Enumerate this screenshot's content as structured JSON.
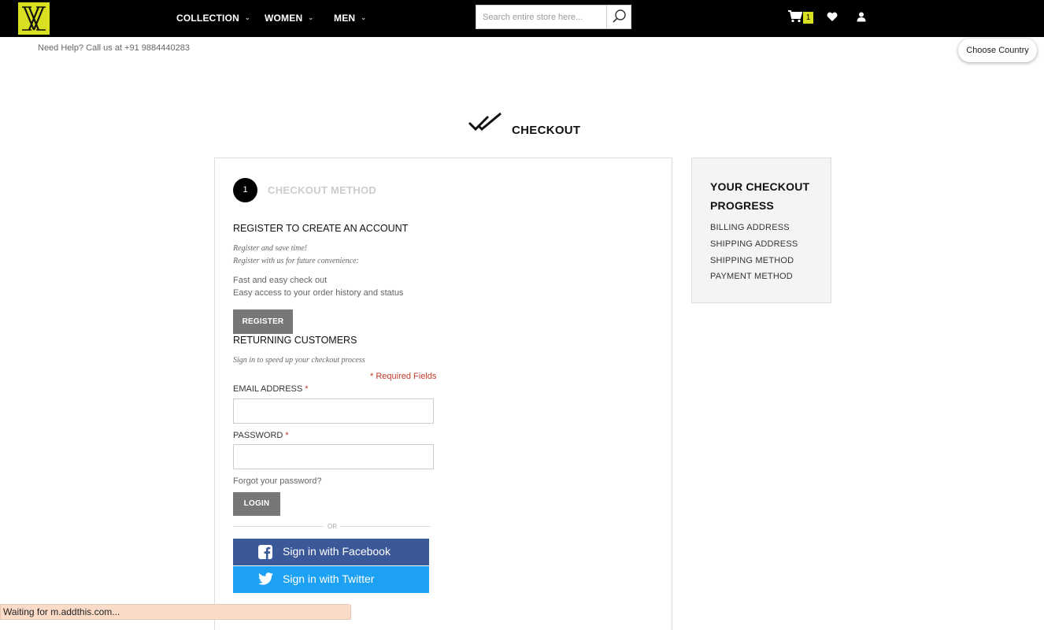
{
  "header": {
    "logo_letter": "XX",
    "nav": [
      {
        "label": "COLLECTION"
      },
      {
        "label": "WOMEN"
      },
      {
        "label": "MEN"
      }
    ],
    "search": {
      "placeholder": "Search entire store here..."
    },
    "cart_count": "1",
    "icons": {
      "search": "magnifier-icon",
      "cart": "cart-icon",
      "wishlist": "heart-icon",
      "account": "user-icon",
      "chevron": "chevron-down-icon"
    },
    "accent_color": "#d9e021"
  },
  "help_text": "Need Help? Call us at +91 9884440283",
  "choose_country": "Choose Country",
  "page_title": "CHECKOUT",
  "checkout_method": {
    "step_number": "1",
    "step_title": "CHECKOUT METHOD",
    "register": {
      "heading": "REGISTER TO CREATE AN ACCOUNT",
      "note_line1": "Register and save time!",
      "note_line2": "Register with us for future convenience:",
      "benefit1": "Fast and easy check out",
      "benefit2": "Easy access to your order history and status",
      "button": "REGISTER"
    },
    "returning": {
      "heading": "RETURNING CUSTOMERS",
      "note": "Sign in to speed up your checkout process",
      "required": "* Required Fields",
      "email_label": "EMAIL ADDRESS",
      "password_label": "PASSWORD",
      "required_star": "*",
      "forgot": "Forgot your password?",
      "login_button": "LOGIN",
      "or": "OR",
      "facebook": "Sign in with Facebook",
      "twitter": "Sign in with Twitter"
    }
  },
  "progress": {
    "title": "YOUR CHECKOUT PROGRESS",
    "items": [
      "BILLING ADDRESS",
      "SHIPPING ADDRESS",
      "SHIPPING METHOD",
      "PAYMENT METHOD"
    ]
  },
  "status_bar": "Waiting for m.addthis.com..."
}
